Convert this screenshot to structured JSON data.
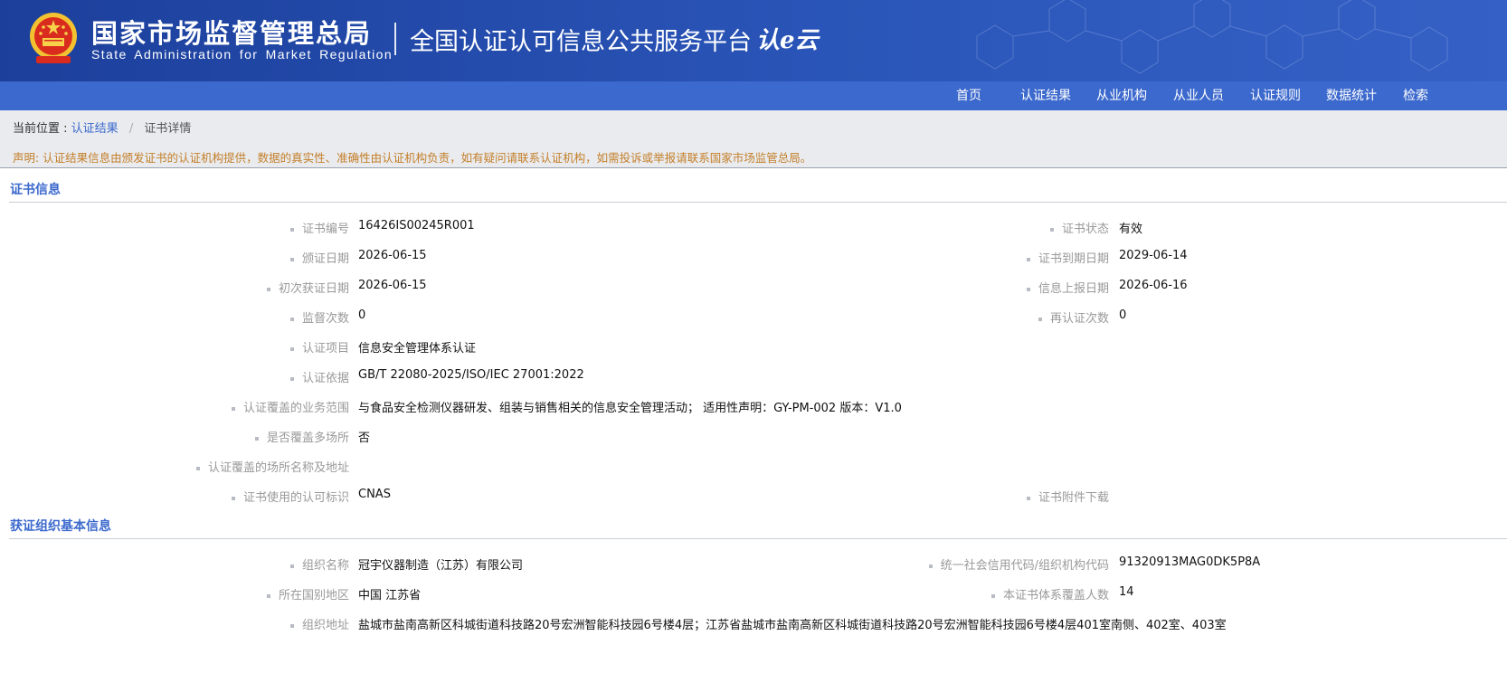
{
  "header": {
    "agency_cn": "国家市场监督管理总局",
    "agency_en": "State Administration for Market Regulation",
    "platform_title": "全国认证认可信息公共服务平台",
    "logo_text": "认e云"
  },
  "nav": {
    "items": [
      "首页",
      "认证结果",
      "从业机构",
      "从业人员",
      "认证规则",
      "数据统计",
      "检索"
    ]
  },
  "breadcrumb": {
    "prefix": "当前位置 :",
    "link": "认证结果",
    "separator": "/",
    "current": "证书详情"
  },
  "notice": "声明: 认证结果信息由颁发证书的认证机构提供，数据的真实性、准确性由认证机构负责，如有疑问请联系认证机构，如需投诉或举报请联系国家市场监管总局。",
  "cert_section": {
    "title": "证书信息",
    "left": [
      {
        "label": "证书编号",
        "value": "16426IS00245R001"
      },
      {
        "label": "颁证日期",
        "value": "2026-06-15"
      },
      {
        "label": "初次获证日期",
        "value": "2026-06-15"
      },
      {
        "label": "监督次数",
        "value": "0"
      },
      {
        "label": "认证项目",
        "value": "信息安全管理体系认证"
      },
      {
        "label": "认证依据",
        "value": "GB/T 22080-2025/ISO/IEC 27001:2022"
      },
      {
        "label": "认证覆盖的业务范围",
        "value": "与食品安全检测仪器研发、组装与销售相关的信息安全管理活动； 适用性声明：GY-PM-002 版本：V1.0"
      },
      {
        "label": "是否覆盖多场所",
        "value": "否"
      },
      {
        "label": "认证覆盖的场所名称及地址",
        "value": ""
      },
      {
        "label": "证书使用的认可标识",
        "value": "CNAS"
      }
    ],
    "right": [
      {
        "label": "证书状态",
        "value": "有效"
      },
      {
        "label": "证书到期日期",
        "value": "2029-06-14"
      },
      {
        "label": "信息上报日期",
        "value": "2026-06-16"
      },
      {
        "label": "再认证次数",
        "value": "0"
      },
      {
        "label": "证书附件下载",
        "value": ""
      }
    ]
  },
  "org_section": {
    "title": "获证组织基本信息",
    "left": [
      {
        "label": "组织名称",
        "value": "冠宇仪器制造（江苏）有限公司"
      },
      {
        "label": "所在国别地区",
        "value": "中国 江苏省"
      },
      {
        "label": "组织地址",
        "value": "盐城市盐南高新区科城街道科技路20号宏洲智能科技园6号楼4层；江苏省盐城市盐南高新区科城街道科技路20号宏洲智能科技园6号楼4层401室南侧、402室、403室"
      }
    ],
    "right": [
      {
        "label": "统一社会信用代码/组织机构代码",
        "value": "91320913MAG0DK5P8A"
      },
      {
        "label": "本证书体系覆盖人数",
        "value": "14"
      }
    ]
  },
  "colors": {
    "header_dark": "#1c3f9b",
    "nav_blue": "#3c69cd",
    "notice_orange": "#c47f2a",
    "label_gray": "#999999"
  }
}
